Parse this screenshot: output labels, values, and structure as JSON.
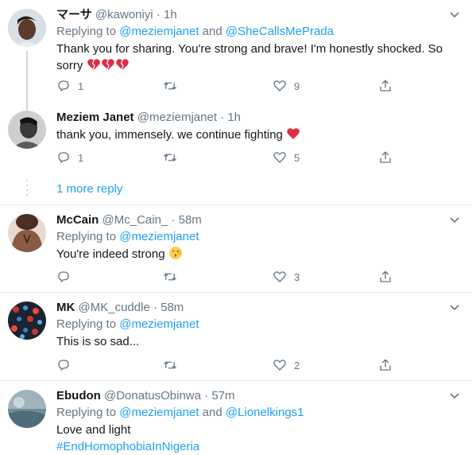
{
  "tweets": [
    {
      "name": "マーサ",
      "handle": "@kawoniyi",
      "dot": "·",
      "time": "1h",
      "replying_prefix": "Replying to",
      "replying_to": [
        "@meziemjanet",
        "@SheCallsMePrada"
      ],
      "replying_and": "and",
      "text": "Thank you for sharing. You're strong and brave! I'm honestly shocked. So sorry",
      "emoji": [
        "broken-heart",
        "broken-heart",
        "broken-heart"
      ],
      "replies": "1",
      "retweets": "",
      "likes": "9"
    },
    {
      "name": "Meziem Janet",
      "handle": "@meziemjanet",
      "dot": "·",
      "time": "1h",
      "text": "thank you, immensely. we continue fighting",
      "emoji": [
        "red-heart"
      ],
      "replies": "1",
      "retweets": "",
      "likes": "5"
    },
    {
      "name": "McCain",
      "handle": "@Mc_Cain_",
      "dot": "·",
      "time": "58m",
      "replying_prefix": "Replying to",
      "replying_to": [
        "@meziemjanet"
      ],
      "text": "You're indeed strong",
      "emoji": [
        "kissing-face"
      ],
      "replies": "",
      "retweets": "",
      "likes": "3"
    },
    {
      "name": "MK",
      "handle": "@MK_cuddle",
      "dot": "·",
      "time": "58m",
      "replying_prefix": "Replying to",
      "replying_to": [
        "@meziemjanet"
      ],
      "text": "This is so sad...",
      "replies": "",
      "retweets": "",
      "likes": "2"
    },
    {
      "name": "Ebudon",
      "handle": "@DonatusObinwa",
      "dot": "·",
      "time": "57m",
      "replying_prefix": "Replying to",
      "replying_to": [
        "@meziemjanet",
        "@Lionelkings1"
      ],
      "replying_and": "and",
      "text": "Love and light",
      "hashtag": "#EndHomophobiaInNigeria"
    }
  ],
  "more_replies": "1 more reply",
  "icons": {
    "reply": "reply-icon",
    "retweet": "retweet-icon",
    "like": "like-icon",
    "share": "share-icon",
    "more": "chevron-down-icon"
  },
  "colors": {
    "accent": "#1da1f2",
    "muted": "#657786",
    "text": "#14171a",
    "divider": "#e6ecf0",
    "heart_red": "#e0245e"
  }
}
